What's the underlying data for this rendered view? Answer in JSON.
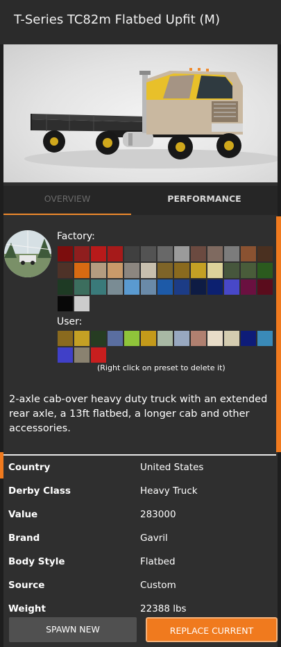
{
  "header": {
    "title": "T-Series TC82m Flatbed Upfit (M)"
  },
  "tabs": [
    {
      "label": "OVERVIEW",
      "active": true
    },
    {
      "label": "PERFORMANCE",
      "active": false
    }
  ],
  "paints": {
    "factory_label": "Factory:",
    "user_label": "User:",
    "delete_hint": "(Right click on preset to delete it)",
    "factory_colors": [
      "#7c0d0d",
      "#8f1e1e",
      "#b81a1a",
      "#a61a1a",
      "#404040",
      "#535353",
      "#686868",
      "#9b9b9b",
      "#6b4a40",
      "#7f6a60",
      "#7c7c7c",
      "#8a5231",
      "#4a3020",
      "#4e3228",
      "#d86a12",
      "#b49c80",
      "#c99a6a",
      "#8c8680",
      "#c7bfae",
      "#7e6428",
      "#8a6a1e",
      "#c4a024",
      "#ddd29a",
      "#46563c",
      "#495c3a",
      "#2b5a1e",
      "#1e3a24",
      "#3c6e5e",
      "#3a7a7a",
      "#7a8c94",
      "#5a9ad0",
      "#6a8aa8",
      "#1d5aa8",
      "#1c3c86",
      "#0e1c44",
      "#0c2070",
      "#4848c8",
      "#6a1040",
      "#5a0c1c",
      "#080808",
      "#cccccc"
    ],
    "user_colors": [
      "#8a6a1e",
      "#c4a024",
      "#263c22",
      "#5a6ea0",
      "#8fc43a",
      "#c49a1a",
      "#a8b8a4",
      "#98a8c0",
      "#b08070",
      "#e8dcc8",
      "#d4ccb0",
      "#0e1c78",
      "#3a8ab8",
      "#4040c8",
      "#8a8270",
      "#c81e1e"
    ]
  },
  "description": "2-axle cab-over heavy duty truck with an extended rear axle, a 13ft flatbed, a longer cab and other accessories.",
  "specs": [
    {
      "key": "Country",
      "value": "United States"
    },
    {
      "key": "Derby Class",
      "value": "Heavy Truck"
    },
    {
      "key": "Value",
      "value": "283000"
    },
    {
      "key": "Brand",
      "value": "Gavril"
    },
    {
      "key": "Body Style",
      "value": "Flatbed"
    },
    {
      "key": "Source",
      "value": "Custom"
    },
    {
      "key": "Weight",
      "value": "22388 lbs"
    }
  ],
  "buttons": {
    "spawn": "SPAWN NEW",
    "replace": "REPLACE CURRENT"
  },
  "colors": {
    "accent": "#f07a1e",
    "panel": "#2f2f2f",
    "tab_bg": "#262626"
  }
}
